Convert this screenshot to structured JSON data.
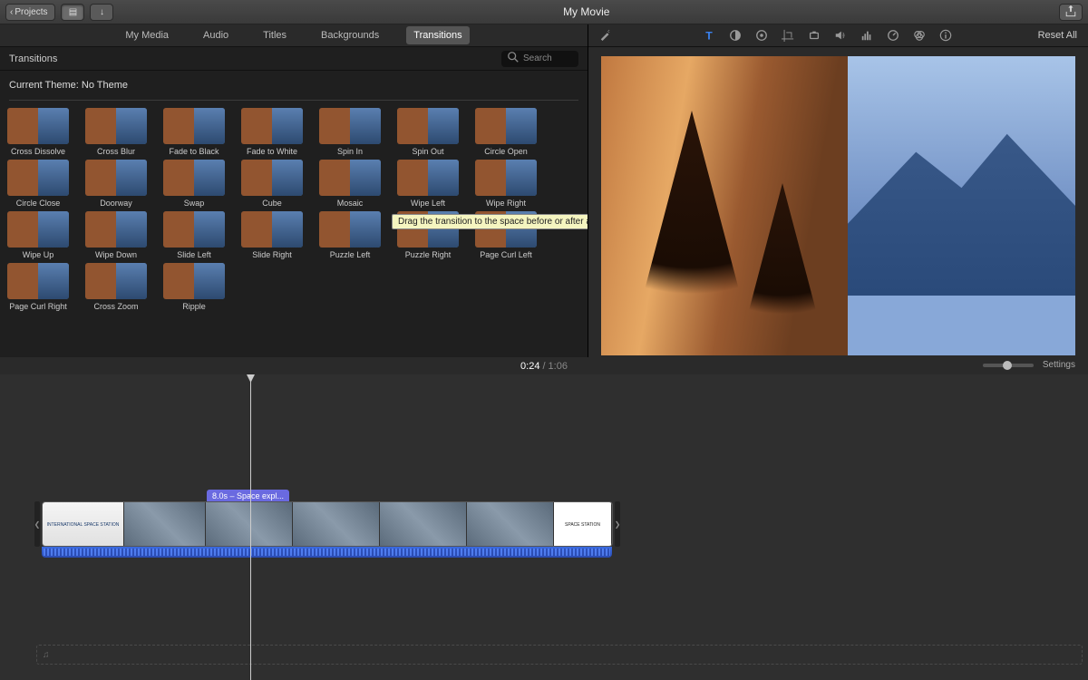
{
  "titlebar": {
    "projects_label": "Projects",
    "title": "My Movie"
  },
  "tabs": [
    "My Media",
    "Audio",
    "Titles",
    "Backgrounds",
    "Transitions"
  ],
  "active_tab_index": 4,
  "browser": {
    "heading": "Transitions",
    "search_placeholder": "Search",
    "theme_label": "Current Theme: No Theme",
    "tooltip": "Drag the transition to the space before or after a clip"
  },
  "transitions": [
    "Cross Dissolve",
    "Cross Blur",
    "Fade to Black",
    "Fade to White",
    "Spin In",
    "Spin Out",
    "Circle Open",
    "Circle Close",
    "Doorway",
    "Swap",
    "Cube",
    "Mosaic",
    "Wipe Left",
    "Wipe Right",
    "Wipe Up",
    "Wipe Down",
    "Slide Left",
    "Slide Right",
    "Puzzle Left",
    "Puzzle Right",
    "Page Curl Left",
    "Page Curl Right",
    "Cross Zoom",
    "Ripple"
  ],
  "viewer_toolbar": {
    "icons": [
      {
        "name": "magic-wand-icon"
      },
      {
        "name": "text-icon",
        "accent": true
      },
      {
        "name": "color-balance-icon"
      },
      {
        "name": "color-wheel-icon"
      },
      {
        "name": "crop-icon"
      },
      {
        "name": "stabilize-icon"
      },
      {
        "name": "volume-icon"
      },
      {
        "name": "equalizer-icon"
      },
      {
        "name": "speed-icon"
      },
      {
        "name": "filter-icon"
      },
      {
        "name": "info-icon"
      }
    ],
    "reset_label": "Reset All"
  },
  "timecode": {
    "current": "0:24",
    "sep": "/",
    "total": "1:06"
  },
  "timeline": {
    "settings_label": "Settings",
    "clip_label": "8.0s – Space expl...",
    "title_clip_text": "INTERNATIONAL SPACE STATION",
    "end_clip_text": "SPACE STATION",
    "music_icon": "♫"
  }
}
